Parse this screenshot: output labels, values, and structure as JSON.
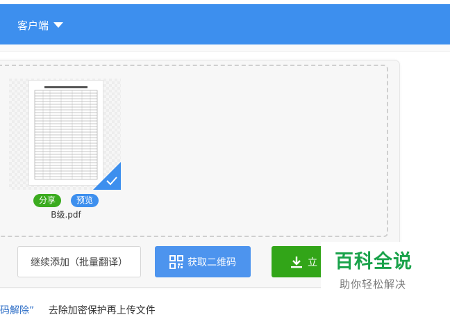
{
  "header": {
    "client_menu_label": "客户端"
  },
  "file": {
    "name": "B级.pdf",
    "share_label": "分享",
    "preview_label": "预览",
    "selected": true
  },
  "actions": {
    "continue_label": "继续添加（批量翻译）",
    "qr_label": "获取二维码",
    "download_label": "立"
  },
  "watermark": {
    "title": "百科全说",
    "subtitle": "助你轻松解决"
  },
  "footer": {
    "link_text": "码解除”",
    "description": "去除加密保护再上传文件"
  },
  "colors": {
    "header": "#3d8fee",
    "share_tag": "#3bab1f",
    "preview_tag": "#3d8fee",
    "qr_button": "#4d94ee",
    "download_button": "#32a518",
    "watermark_green": "#19a24a"
  },
  "icons": {
    "client_caret": "caret-down-icon",
    "selected_check": "checkmark-icon",
    "qr": "qr-code-icon",
    "download": "download-icon"
  }
}
